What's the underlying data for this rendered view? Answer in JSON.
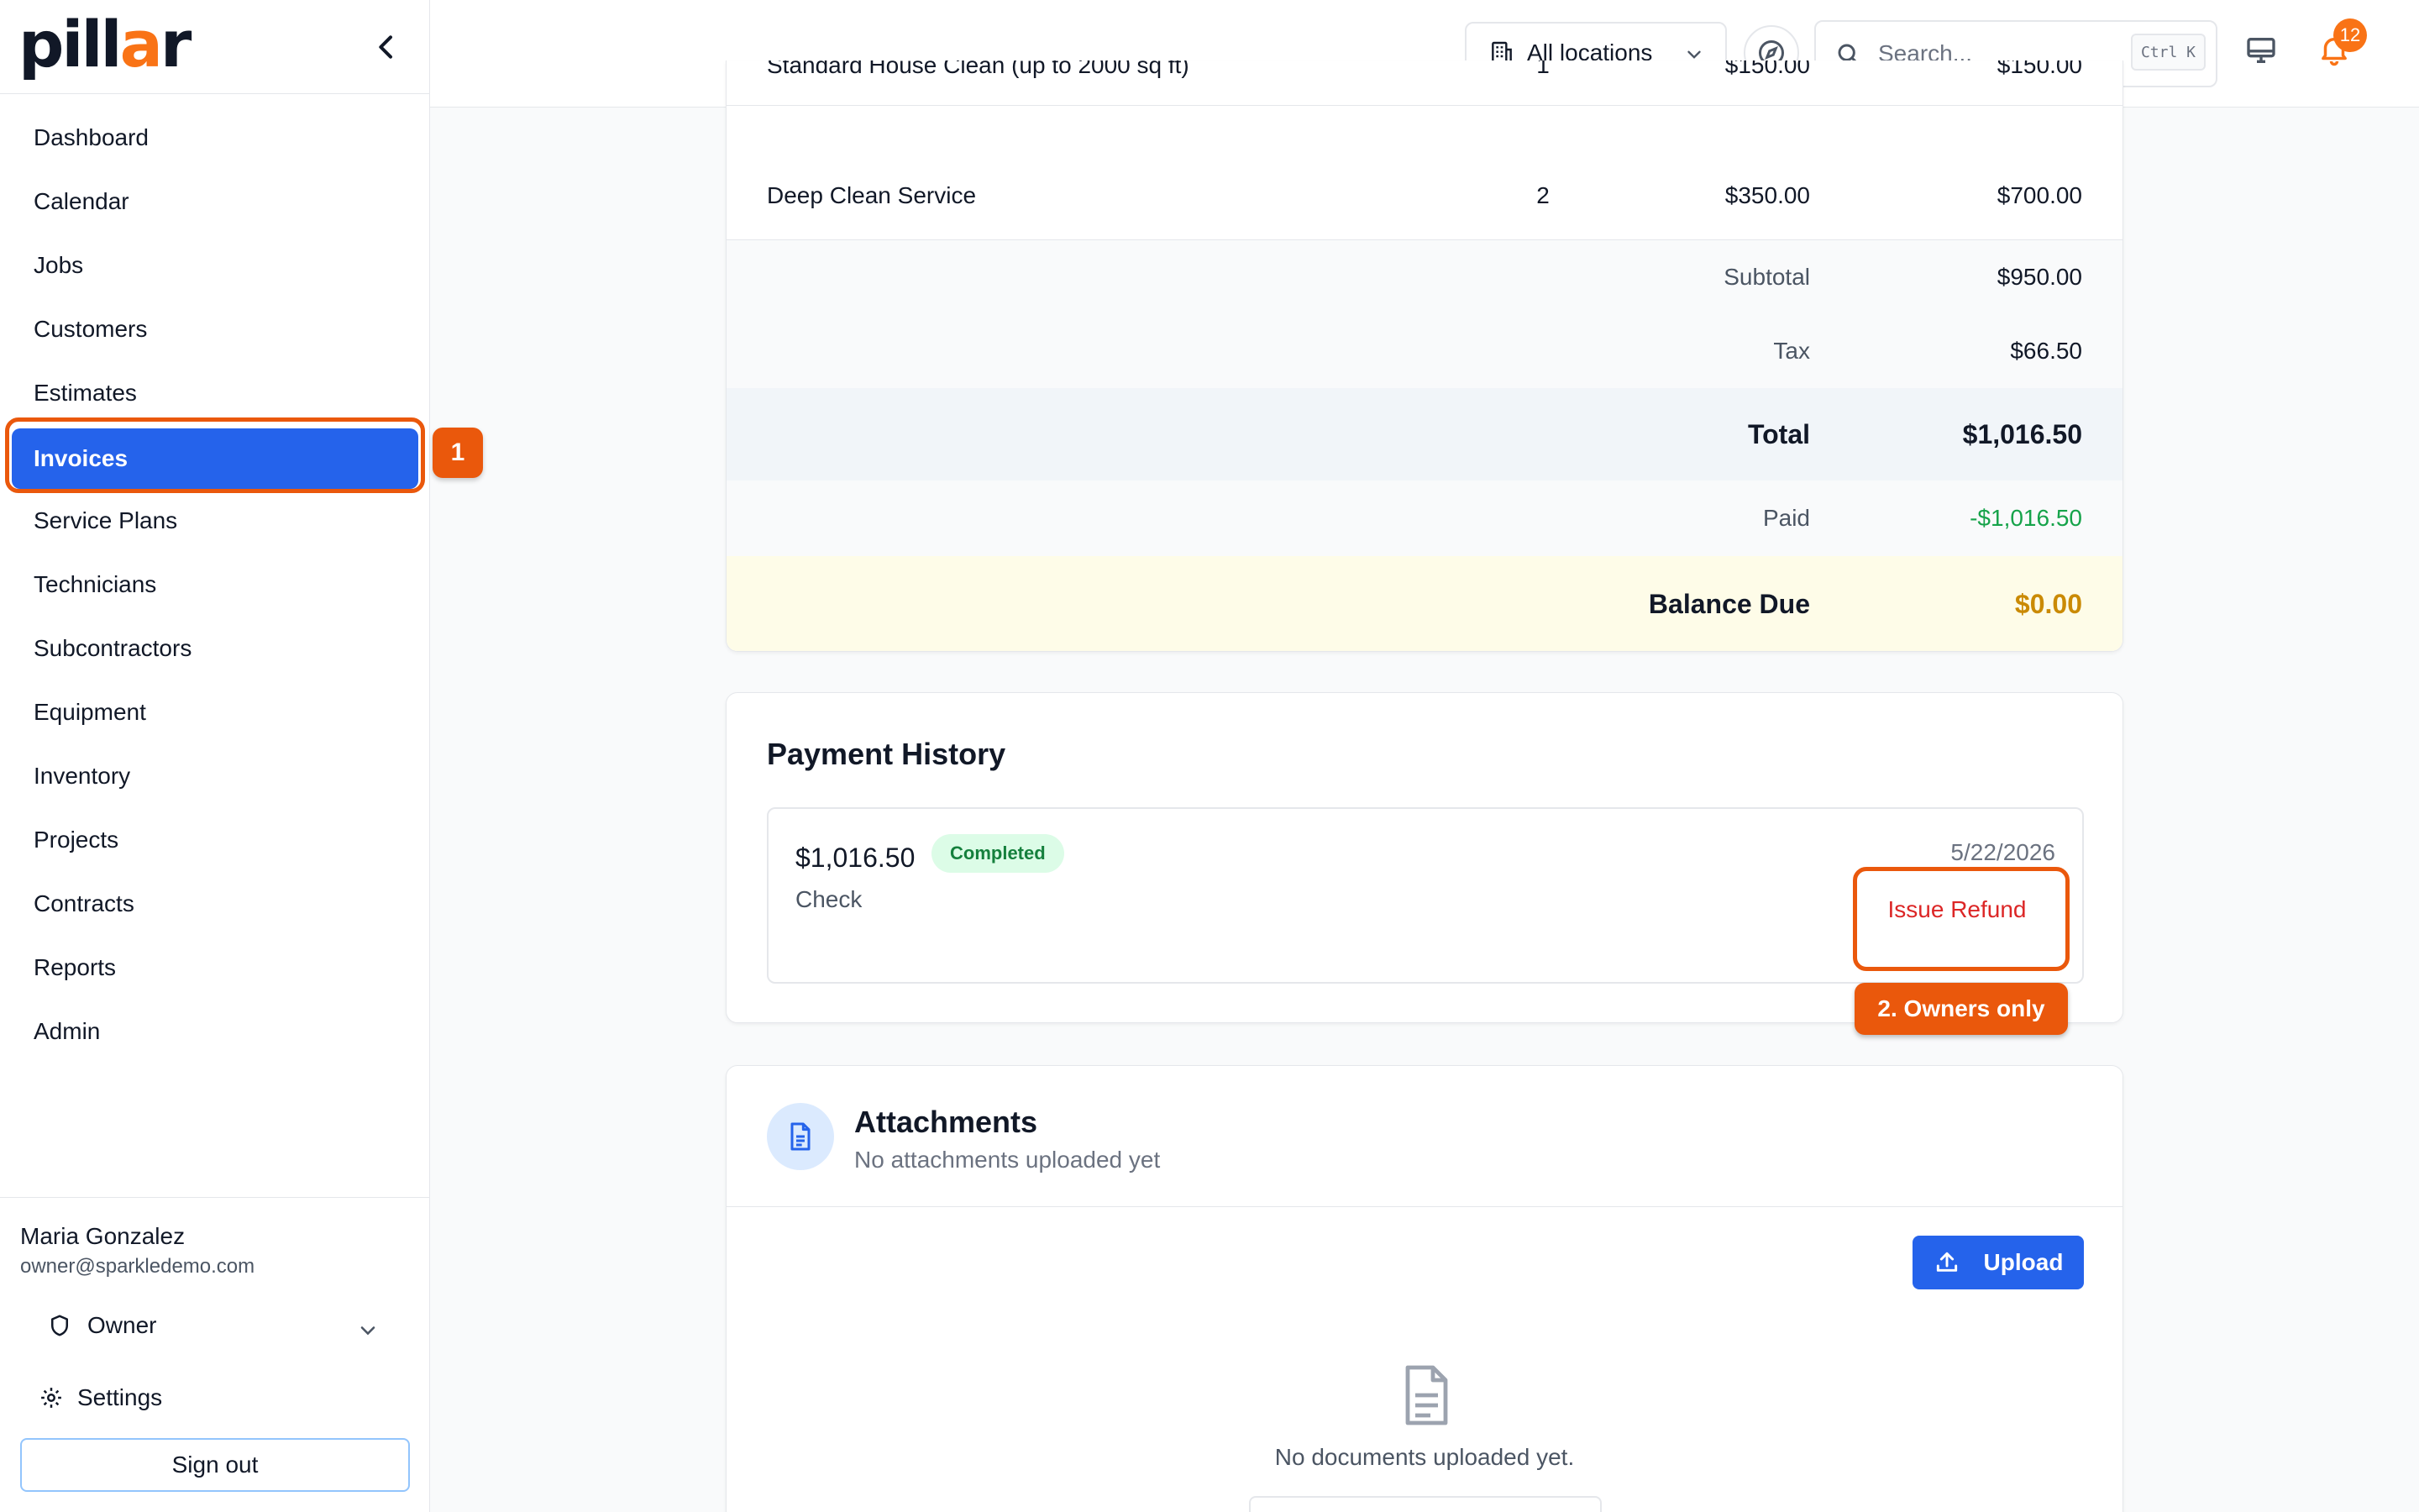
{
  "app": {
    "logo_text_pre": "pill",
    "logo_text_accent": "a",
    "logo_text_post": "r"
  },
  "sidebar": {
    "items": [
      {
        "label": "Dashboard"
      },
      {
        "label": "Calendar"
      },
      {
        "label": "Jobs"
      },
      {
        "label": "Customers"
      },
      {
        "label": "Estimates"
      },
      {
        "label": "Invoices",
        "active": true
      },
      {
        "label": "Service Plans"
      },
      {
        "label": "Technicians"
      },
      {
        "label": "Subcontractors"
      },
      {
        "label": "Equipment"
      },
      {
        "label": "Inventory"
      },
      {
        "label": "Projects"
      },
      {
        "label": "Contracts"
      },
      {
        "label": "Reports"
      },
      {
        "label": "Admin"
      }
    ],
    "user": {
      "name": "Maria Gonzalez",
      "email": "owner@sparkledemo.com",
      "role": "Owner"
    },
    "settings_label": "Settings",
    "signout_label": "Sign out"
  },
  "annotations": {
    "step1": "1",
    "step2": "2. Owners only"
  },
  "topbar": {
    "location": "All locations",
    "search_placeholder": "Search...",
    "shortcut": "Ctrl K",
    "notification_count": "12"
  },
  "invoice": {
    "items": [
      {
        "desc": "Standard House Clean (up to 2000 sq ft)",
        "qty": "1",
        "price": "$150.00",
        "amount": "$150.00"
      },
      {
        "desc": "Deep Clean Service",
        "qty": "2",
        "price": "$350.00",
        "amount": "$700.00"
      }
    ],
    "subtotal_label": "Subtotal",
    "subtotal": "$950.00",
    "tax_label": "Tax",
    "tax": "$66.50",
    "total_label": "Total",
    "total": "$1,016.50",
    "paid_label": "Paid",
    "paid": "-$1,016.50",
    "balance_label": "Balance Due",
    "balance": "$0.00"
  },
  "payment_history": {
    "title": "Payment History",
    "entries": [
      {
        "amount": "$1,016.50",
        "status": "Completed",
        "method": "Check",
        "date": "5/22/2026",
        "action": "Issue Refund"
      }
    ]
  },
  "attachments": {
    "title": "Attachments",
    "subtitle": "No attachments uploaded yet",
    "upload_label": "Upload",
    "empty_text": "No documents uploaded yet."
  },
  "colors": {
    "accent": "#2563eb",
    "annotation": "#ea580c",
    "paid": "#16a34a",
    "balance": "#ca8a04",
    "refund": "#dc2626"
  }
}
